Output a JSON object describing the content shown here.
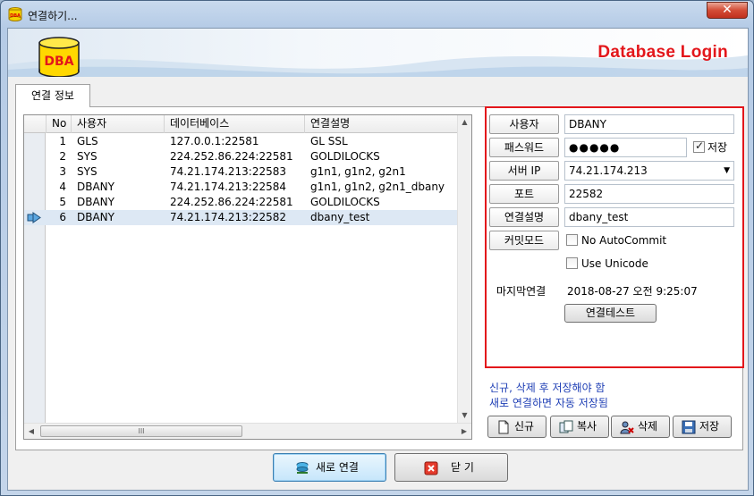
{
  "window": {
    "title": "연결하기...",
    "close_glyph": "✕",
    "title_icon_text": "DBA"
  },
  "banner": {
    "logo_text": "DBA",
    "title": "Database Login"
  },
  "tab": {
    "label": "연결 정보"
  },
  "grid": {
    "columns": [
      "No",
      "사용자",
      "데이터베이스",
      "연결설명"
    ],
    "rows": [
      {
        "no": "1",
        "user": "GLS",
        "db": "127.0.0.1:22581",
        "desc": "GL SSL"
      },
      {
        "no": "2",
        "user": "SYS",
        "db": "224.252.86.224:22581",
        "desc": "GOLDILOCKS"
      },
      {
        "no": "3",
        "user": "SYS",
        "db": "74.21.174.213:22583",
        "desc": "g1n1, g1n2, g2n1"
      },
      {
        "no": "4",
        "user": "DBANY",
        "db": "74.21.174.213:22584",
        "desc": "g1n1, g1n2, g2n1_dbany"
      },
      {
        "no": "5",
        "user": "DBANY",
        "db": "224.252.86.224:22581",
        "desc": "GOLDILOCKS"
      },
      {
        "no": "6",
        "user": "DBANY",
        "db": "74.21.174.213:22582",
        "desc": "dbany_test"
      }
    ],
    "selected_index": 5,
    "scroll": {
      "thumb_glyph": "III",
      "up": "▲",
      "down": "▼",
      "left": "◀",
      "right": "▶"
    }
  },
  "login": {
    "user_label": "사용자",
    "user_value": "DBANY",
    "password_label": "패스워드",
    "password_value": "●●●●●",
    "save_label": "저장",
    "save_checked": true,
    "server_label": "서버 IP",
    "server_value": "74.21.174.213",
    "server_dropdown": "▼",
    "port_label": "포트",
    "port_value": "22582",
    "desc_label": "연결설명",
    "desc_value": "dbany_test",
    "commit_label": "커밋모드",
    "no_autocommit_label": "No AutoCommit",
    "no_autocommit_checked": false,
    "unicode_label": "Use Unicode",
    "unicode_checked": false,
    "last_conn_label": "마지막연결",
    "last_conn_value": "2018-08-27 오전 9:25:07",
    "test_button": "연결테스트"
  },
  "notes": {
    "line1": "신규, 삭제 후 저장해야 함",
    "line2": "새로 연결하면 자동 저장됨"
  },
  "actions": {
    "new": "신규",
    "copy": "복사",
    "delete": "삭제",
    "save": "저장"
  },
  "footer": {
    "connect": "새로 연결",
    "close": "닫  기"
  },
  "colors": {
    "accent_red": "#e3161b",
    "note_blue": "#1f3fb5",
    "selected_row": "#dde8f4"
  }
}
